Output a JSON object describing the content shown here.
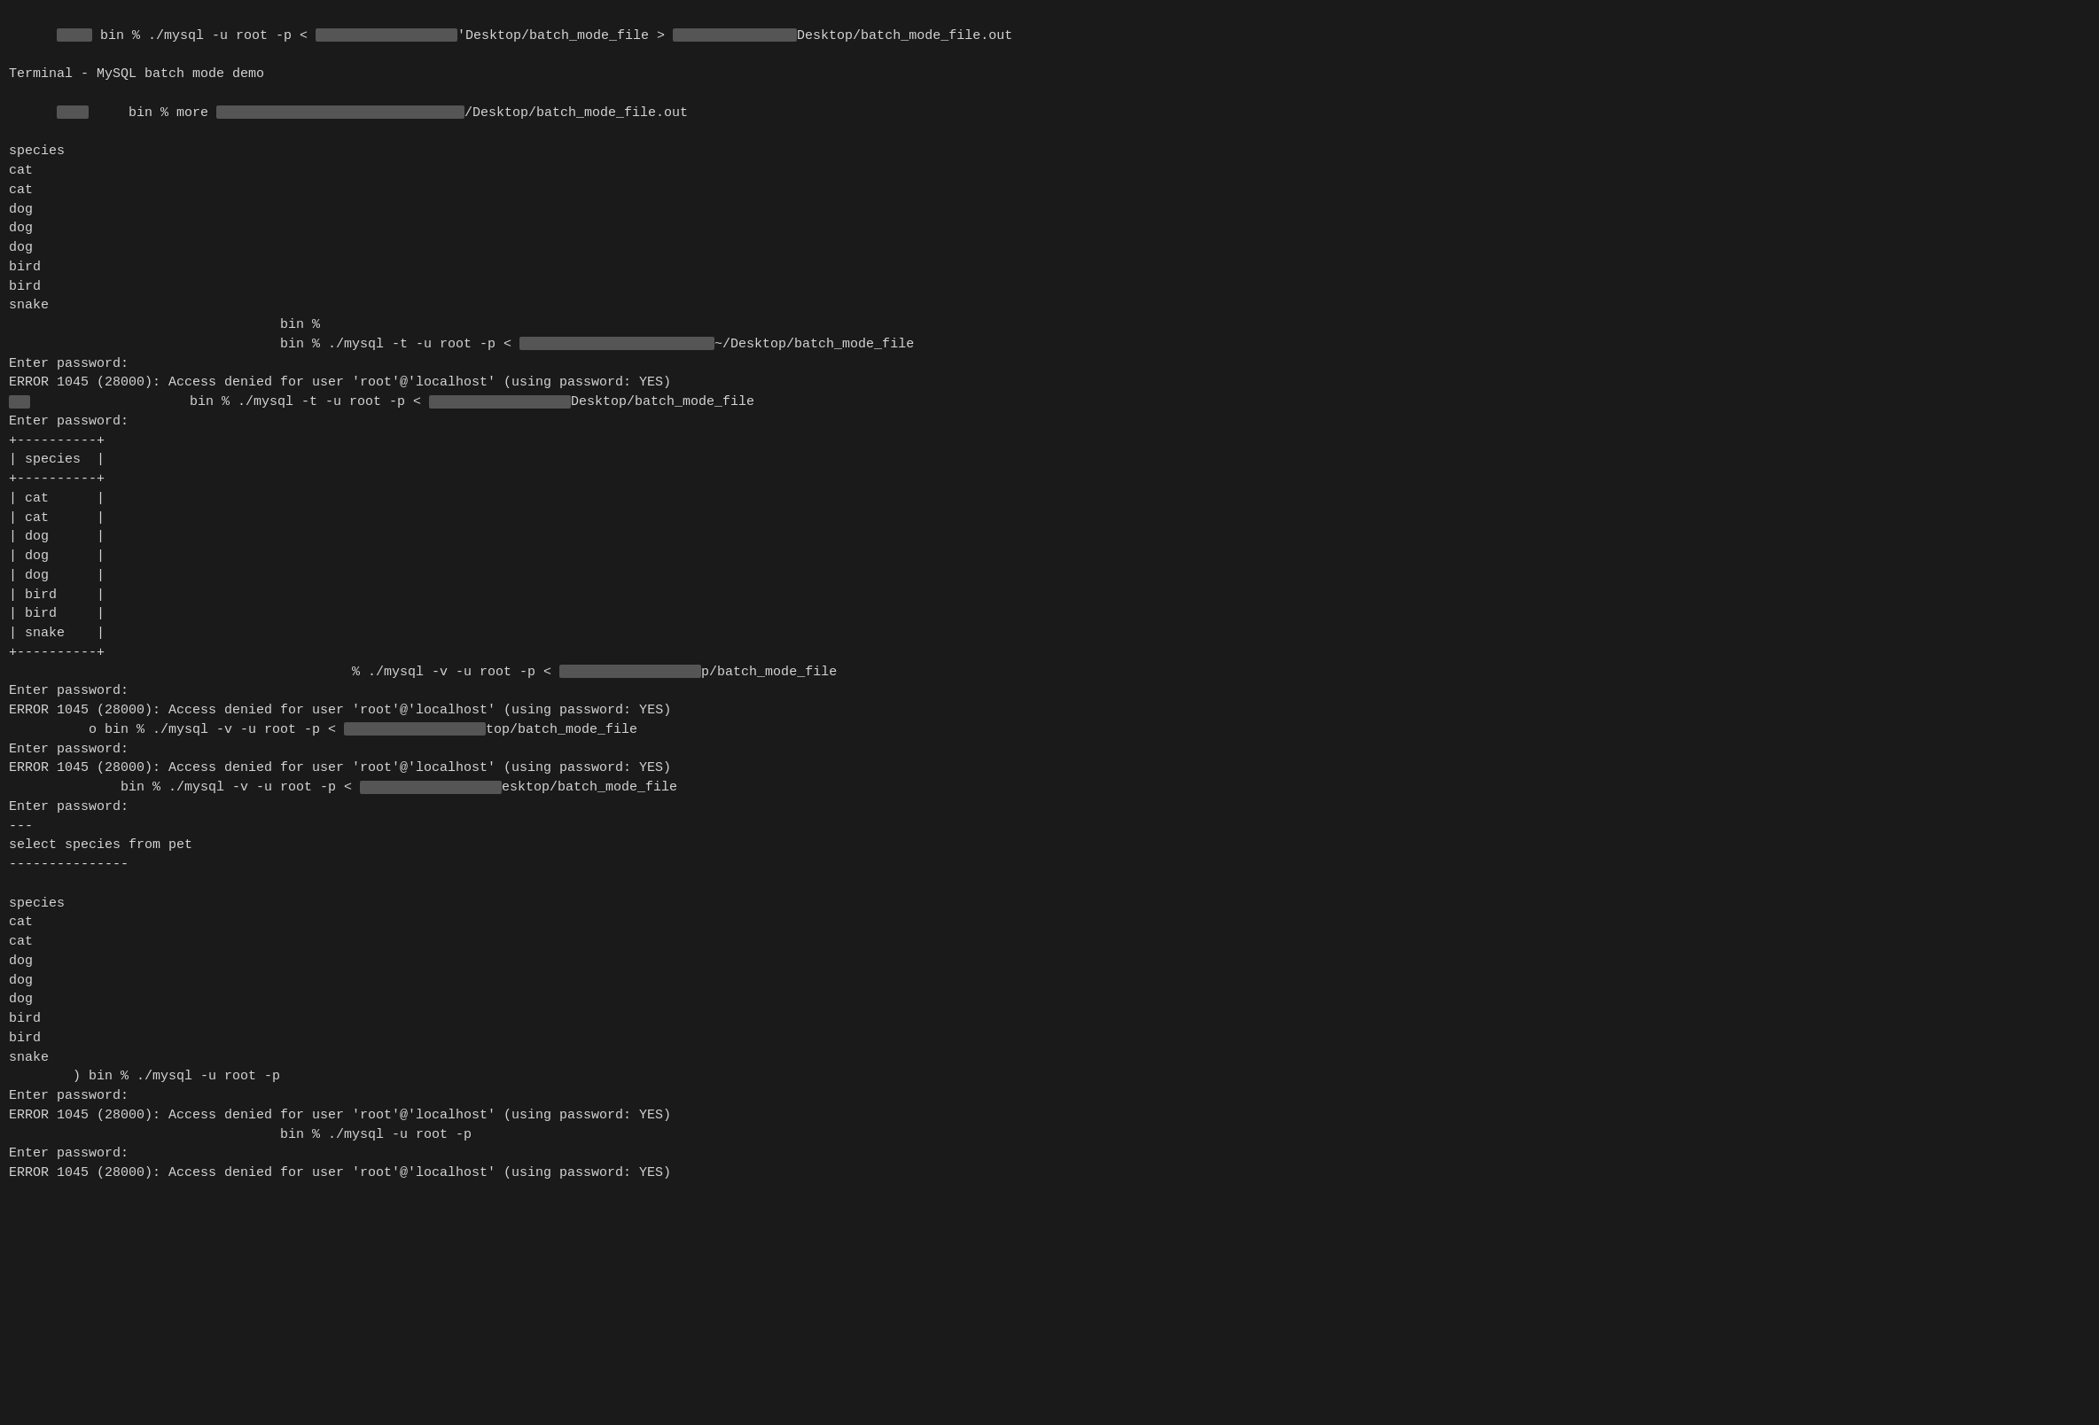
{
  "terminal": {
    "title": "Terminal - MySQL batch mode demo",
    "bg": "#1a1a1a",
    "fg": "#d4d4d4",
    "lines": [
      {
        "type": "prompt",
        "content": " bin % ./mysql -u root -p <",
        "redacted_mid": true,
        "mid_width": 160,
        "suffix": "'Desktop/batch_mode_file >",
        "suffix_redacted": true,
        "suffix2_width": 200,
        "suffix2": "Desktop/batch_mode_file.out"
      },
      {
        "type": "password",
        "content": "Enter password:"
      },
      {
        "type": "prompt2",
        "content": "     bin % more",
        "redacted": true,
        "redacted_width": 300,
        "suffix": "/Desktop/batch_mode_file.out"
      },
      {
        "type": "output",
        "lines": [
          "species",
          "cat",
          "cat",
          "dog",
          "dog",
          "dog",
          "bird",
          "bird",
          "snake"
        ]
      },
      {
        "type": "prompt3",
        "content": "                                  bin %"
      },
      {
        "type": "prompt3",
        "content": "                                  bin % ./mysql -t -u root -p <",
        "redacted": true,
        "redacted_width": 220,
        "suffix": "~/Desktop/batch_mode_file"
      },
      {
        "type": "password",
        "content": "Enter password:"
      },
      {
        "type": "error",
        "content": "ERROR 1045 (28000): Access denied for user 'root'@'localhost' (using password: YES)"
      },
      {
        "type": "prompt3",
        "content": "                    bin % ./mysql -t -u root -p <",
        "redacted": true,
        "redacted_width": 160,
        "suffix": "Desktop/batch_mode_file"
      },
      {
        "type": "password",
        "content": "Enter password:"
      },
      {
        "type": "table",
        "lines": [
          "+----------+",
          "| species  |",
          "+----------+",
          "| cat      |",
          "| cat      |",
          "| dog      |",
          "| dog      |",
          "| dog      |",
          "| bird     |",
          "| bird     |",
          "| snake    |",
          "+----------+"
        ]
      },
      {
        "type": "prompt3",
        "content": "                                           % ./mysql -v -u root -p <",
        "redacted": true,
        "redacted_width": 160,
        "suffix": "p/batch_mode_file"
      },
      {
        "type": "password",
        "content": "Enter password:"
      },
      {
        "type": "error",
        "content": "ERROR 1045 (28000): Access denied for user 'root'@'localhost' (using password: YES)"
      },
      {
        "type": "prompt3",
        "content": "          o bin % ./mysql -v -u root -p <",
        "redacted": true,
        "redacted_width": 160,
        "suffix": "top/batch_mode_file"
      },
      {
        "type": "password",
        "content": "Enter password:"
      },
      {
        "type": "error",
        "content": "ERROR 1045 (28000): Access denied for user 'root'@'localhost' (using password: YES)"
      },
      {
        "type": "prompt3",
        "content": "              bin % ./mysql -v -u root -p <",
        "redacted": true,
        "redacted_width": 160,
        "suffix": "esktop/batch_mode_file"
      },
      {
        "type": "password",
        "content": "Enter password:"
      },
      {
        "type": "divider",
        "content": "---"
      },
      {
        "type": "output2",
        "content": "select species from pet"
      },
      {
        "type": "divider2",
        "content": "---------------"
      },
      {
        "type": "blank"
      },
      {
        "type": "output",
        "lines": [
          "species",
          "cat",
          "cat",
          "dog",
          "dog",
          "dog",
          "bird",
          "bird",
          "snake"
        ]
      },
      {
        "type": "prompt3",
        "content": "        ) bin % ./mysql -u root -p"
      },
      {
        "type": "password",
        "content": "Enter password:"
      },
      {
        "type": "error",
        "content": "ERROR 1045 (28000): Access denied for user 'root'@'localhost' (using password: YES)"
      },
      {
        "type": "prompt3",
        "content": "                                  bin % ./mysql -u root -p"
      },
      {
        "type": "password",
        "content": "Enter password:"
      },
      {
        "type": "error",
        "content": "ERROR 1045 (28000): Access denied for user 'root'@'localhost' (using password: YES)"
      }
    ]
  }
}
